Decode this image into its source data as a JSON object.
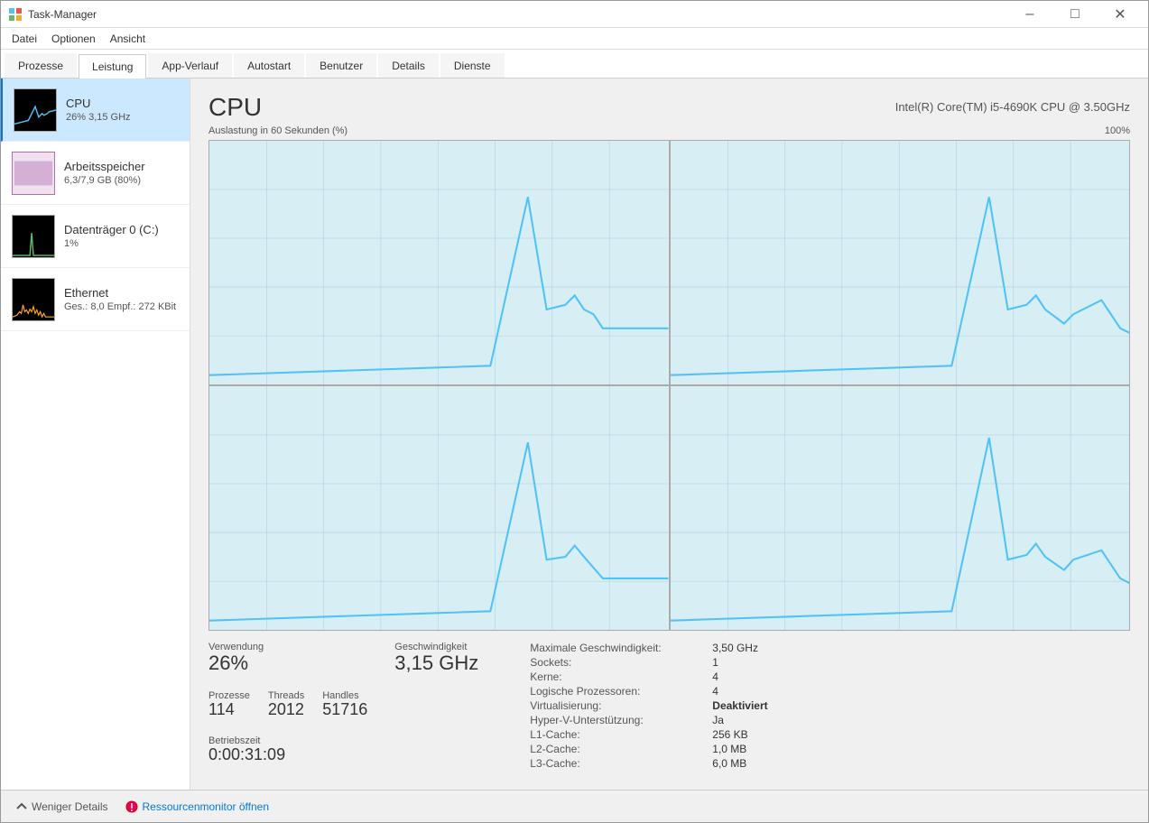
{
  "window": {
    "title": "Task-Manager",
    "controls": [
      "minimize",
      "maximize",
      "close"
    ]
  },
  "menubar": {
    "items": [
      "Datei",
      "Optionen",
      "Ansicht"
    ]
  },
  "tabs": [
    {
      "label": "Prozesse",
      "active": false
    },
    {
      "label": "Leistung",
      "active": true
    },
    {
      "label": "App-Verlauf",
      "active": false
    },
    {
      "label": "Autostart",
      "active": false
    },
    {
      "label": "Benutzer",
      "active": false
    },
    {
      "label": "Details",
      "active": false
    },
    {
      "label": "Dienste",
      "active": false
    }
  ],
  "sidebar": {
    "items": [
      {
        "name": "CPU",
        "value": "26% 3,15 GHz",
        "type": "cpu"
      },
      {
        "name": "Arbeitsspeicher",
        "value": "6,3/7,9 GB (80%)",
        "type": "ram"
      },
      {
        "name": "Datenträger 0 (C:)",
        "value": "1%",
        "type": "disk"
      },
      {
        "name": "Ethernet",
        "value": "Ges.: 8,0 Empf.: 272 KBit",
        "type": "net"
      }
    ]
  },
  "main": {
    "title": "CPU",
    "cpu_model": "Intel(R) Core(TM) i5-4690K CPU @ 3.50GHz",
    "chart_label": "Auslastung in 60 Sekunden (%)",
    "chart_label_right": "100%",
    "stats": {
      "verwendung_label": "Verwendung",
      "verwendung_value": "26%",
      "geschwindigkeit_label": "Geschwindigkeit",
      "geschwindigkeit_value": "3,15 GHz",
      "prozesse_label": "Prozesse",
      "prozesse_value": "114",
      "threads_label": "Threads",
      "threads_value": "2012",
      "handles_label": "Handles",
      "handles_value": "51716",
      "betriebszeit_label": "Betriebszeit",
      "betriebszeit_value": "0:00:31:09"
    },
    "info": {
      "maximale_geschwindigkeit_label": "Maximale Geschwindigkeit:",
      "maximale_geschwindigkeit_value": "3,50 GHz",
      "sockets_label": "Sockets:",
      "sockets_value": "1",
      "kerne_label": "Kerne:",
      "kerne_value": "4",
      "logische_label": "Logische Prozessoren:",
      "logische_value": "4",
      "virt_label": "Virtualisierung:",
      "virt_value": "Deaktiviert",
      "hyper_label": "Hyper-V-Unterstützung:",
      "hyper_value": "Ja",
      "l1_label": "L1-Cache:",
      "l1_value": "256 KB",
      "l2_label": "L2-Cache:",
      "l2_value": "1,0 MB",
      "l3_label": "L3-Cache:",
      "l3_value": "6,0 MB"
    }
  },
  "footer": {
    "less_details_label": "Weniger Details",
    "monitor_label": "Ressourcenmonitor öffnen"
  }
}
